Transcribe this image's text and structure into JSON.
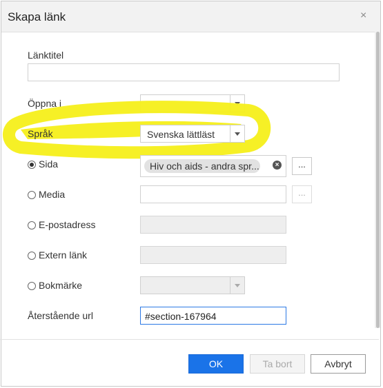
{
  "dialog": {
    "title": "Skapa länk",
    "close_glyph": "×"
  },
  "fields": {
    "link_title_label": "Länktitel",
    "link_title_value": "",
    "open_in_label": "Öppna i",
    "open_in_value": "",
    "language_label": "Språk",
    "language_value": "Svenska lättläst",
    "page_label": "Sida",
    "page_value": "Hiv och aids - andra spr...",
    "media_label": "Media",
    "email_label": "E-postadress",
    "external_label": "Extern länk",
    "bookmark_label": "Bokmärke",
    "remaining_url_label": "Återstående url",
    "remaining_url_value": "#section-167964",
    "browse_label": "..."
  },
  "selected_link_type": "Sida",
  "annotation": {
    "type": "yellow freehand highlight around Språk row",
    "color": "#f5ef1a"
  },
  "buttons": {
    "ok": "OK",
    "delete": "Ta bort",
    "cancel": "Avbryt"
  },
  "colors": {
    "primary": "#1a73e8",
    "highlight": "#f5ef1a"
  }
}
